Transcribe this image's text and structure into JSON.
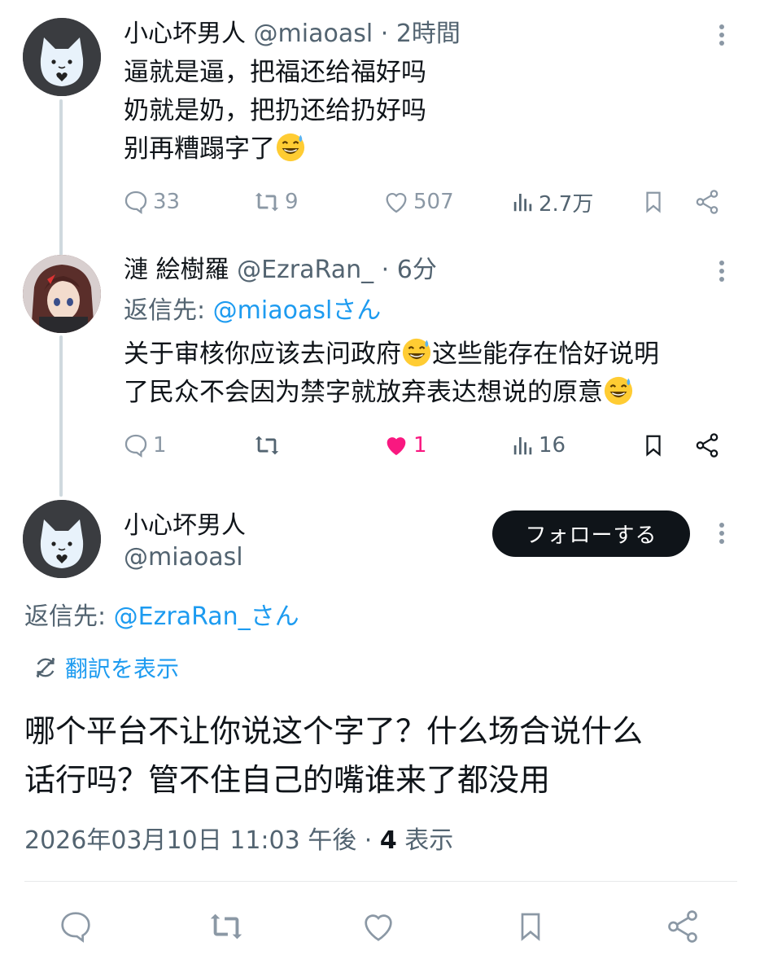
{
  "tweet1": {
    "name": "小心坏男人",
    "handle": "@miaoasl",
    "sep": "·",
    "time": "2時間",
    "lines": [
      "逼就是逼，把福还给福好吗",
      "奶就是奶，把扔还给扔好吗",
      "别再糟蹋字了"
    ],
    "emoji": "sweat-smile-emoji",
    "replies": "33",
    "retweets": "9",
    "likes": "507",
    "views": "2.7万"
  },
  "tweet2": {
    "name": "漣 絵樹羅",
    "handle": "@EzraRan_",
    "sep": "·",
    "time": "6分",
    "reply_prefix": "返信先: ",
    "reply_to": "@miaoaslさん",
    "line1_a": "关于审核你应该去问政府",
    "line1_b": "这些能存在恰好说明",
    "line2": "了民众不会因为禁字就放弃表达想说的原意",
    "replies": "1",
    "likes": "1",
    "views": "16",
    "like_color": "#f91880"
  },
  "main": {
    "name": "小心坏男人",
    "handle": "@miaoasl",
    "follow_label": "フォローする",
    "reply_prefix": "返信先: ",
    "reply_to": "@EzraRan_さん",
    "translate_label": "翻訳を表示",
    "line1": "哪个平台不让你说这个字了？什么场合说什么",
    "line2": "话行吗？管不住自己的嘴谁来了都没用",
    "timestamp": "2026年03月10日 11:03 午後",
    "sep": "·",
    "views_count": "4",
    "views_label": "表示"
  },
  "colors": {
    "accent": "#1d9bf0",
    "text": "#0f1419",
    "muted": "#536471",
    "like": "#f91880"
  }
}
